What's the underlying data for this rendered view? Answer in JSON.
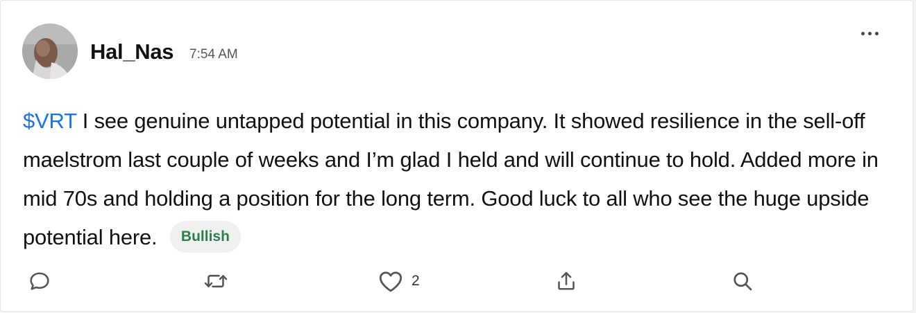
{
  "post": {
    "username": "Hal_Nas",
    "time": "7:54 AM",
    "ticker": "$VRT",
    "text": " I see genuine untapped potential in this company. It showed resilience in the sell-off  maelstrom last couple of weeks and I’m glad I held and will continue to hold. Added more in mid 70s and holding a position for the long term. Good luck to all who see the huge upside potential here.",
    "sentiment": "Bullish",
    "like_count": "2"
  },
  "icons": {
    "menu": "more-horizontal-icon",
    "reply": "comment-icon",
    "repost": "repost-icon",
    "like": "heart-icon",
    "share": "share-icon",
    "search": "search-icon"
  },
  "colors": {
    "ticker": "#1a73e8",
    "bullish_text": "#2e7d4f",
    "bullish_bg": "#eef1ee"
  }
}
